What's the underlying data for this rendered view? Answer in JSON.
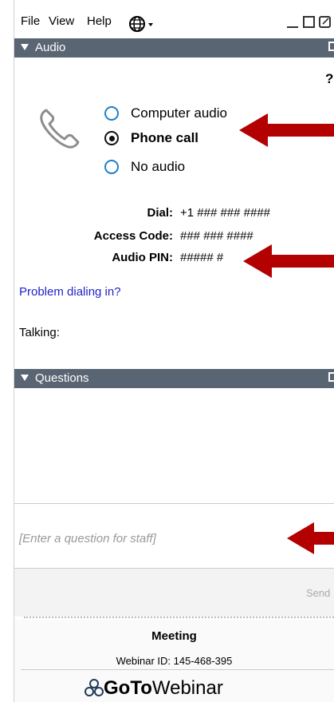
{
  "menu": {
    "file": "File",
    "view": "View",
    "help": "Help"
  },
  "icons": {
    "globe": "globe-icon",
    "phone": "phone-icon",
    "minimize": "minimize-icon",
    "maximize": "maximize-icon",
    "popout": "popout-icon",
    "close": "close-icon",
    "brand": "gotowebinar-logo-icon"
  },
  "audio": {
    "header": "Audio",
    "help": "?",
    "options": [
      {
        "label": "Computer audio",
        "selected": false
      },
      {
        "label": "Phone call",
        "selected": true
      },
      {
        "label": "No audio",
        "selected": false
      }
    ],
    "dial_label": "Dial:",
    "dial_value": "+1 ### ### ####",
    "access_label": "Access Code:",
    "access_value": "### ### ####",
    "pin_label": "Audio PIN:",
    "pin_value": "##### #",
    "problem_link": "Problem dialing in?",
    "talking_label": "Talking:"
  },
  "questions": {
    "header": "Questions",
    "placeholder": "[Enter a question for staff]",
    "send_label": "Send"
  },
  "footer": {
    "meeting": "Meeting",
    "webinar_id": "Webinar ID: 145-468-395",
    "brand_go": "GoTo",
    "brand_rest": "Webinar"
  },
  "colors": {
    "header_bg": "#5a6573",
    "arrow": "#b30000",
    "link": "#2222cc",
    "radio_accent": "#1e7fc8"
  }
}
